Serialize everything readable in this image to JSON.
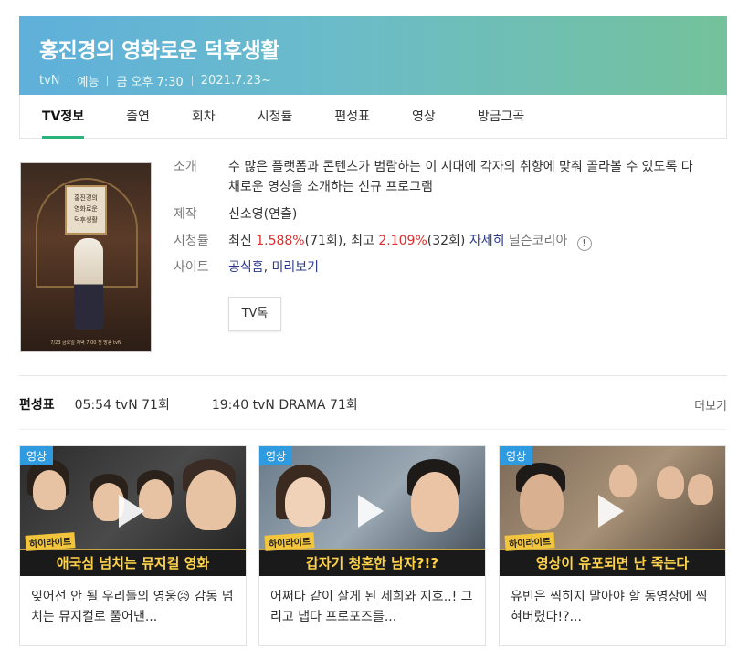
{
  "header": {
    "title": "홍진경의 영화로운 덕후생활",
    "channel": "tvN",
    "genre": "예능",
    "airtime": "금 오후 7:30",
    "start_date": "2021.7.23~"
  },
  "tabs": [
    {
      "label": "TV정보",
      "active": true
    },
    {
      "label": "출연"
    },
    {
      "label": "회차"
    },
    {
      "label": "시청률"
    },
    {
      "label": "편성표"
    },
    {
      "label": "영상"
    },
    {
      "label": "방금그곡"
    }
  ],
  "poster": {
    "title_lines": [
      "홍진경의",
      "영화로운",
      "덕후생활"
    ],
    "caption": "7/23 금요일 저녁 7:00 첫 방송 tvN"
  },
  "info": {
    "intro_label": "소개",
    "intro_text": "수 많은 플랫폼과 콘텐츠가 범람하는 이 시대에 각자의 취향에 맞춰 골라볼 수 있도록 다채로운 영상을 소개하는 신규 프로그램",
    "production_label": "제작",
    "production_value": "신소영(연출)",
    "rating_label": "시청률",
    "rating_latest_prefix": "최신",
    "rating_latest_value": "1.588%",
    "rating_latest_ep": "(71회),",
    "rating_best_prefix": "최고",
    "rating_best_value": "2.109%",
    "rating_best_ep": "(32회)",
    "rating_detail_link": "자세히",
    "rating_source": "닐슨코리아",
    "rating_alert_icon": "!",
    "site_label": "사이트",
    "site_official": "공식홈",
    "site_separator": ",",
    "site_preview": "미리보기",
    "tvtalk_label": "TV톡"
  },
  "schedule": {
    "label": "편성표",
    "items": [
      "05:54 tvN 71회",
      "19:40 tvN DRAMA 71회"
    ],
    "more": "더보기"
  },
  "videos": [
    {
      "badge": "영상",
      "highlight": "하이라이트",
      "banner": "애국심 넘치는 뮤지컬 영화",
      "title": "잊어선 안 될 우리들의 영웅😥 감동 넘치는 뮤지컬로 풀어낸..."
    },
    {
      "badge": "영상",
      "highlight": "하이라이트",
      "banner": "갑자기 청혼한 남자?!?",
      "title": "어쩌다 같이 살게 된 세희와 지호..! 그리고 냅다 프로포즈를..."
    },
    {
      "badge": "영상",
      "highlight": "하이라이트",
      "banner": "영상이 유포되면 난 죽는다",
      "title": "유빈은 찍히지 말아야 할 동영상에 찍혀버렸다!?..."
    }
  ],
  "colors": {
    "accent_green": "#28b47a",
    "rating_red": "#e02b2b",
    "link_blue": "#2b3a8f",
    "badge_blue": "#2e9be0"
  }
}
